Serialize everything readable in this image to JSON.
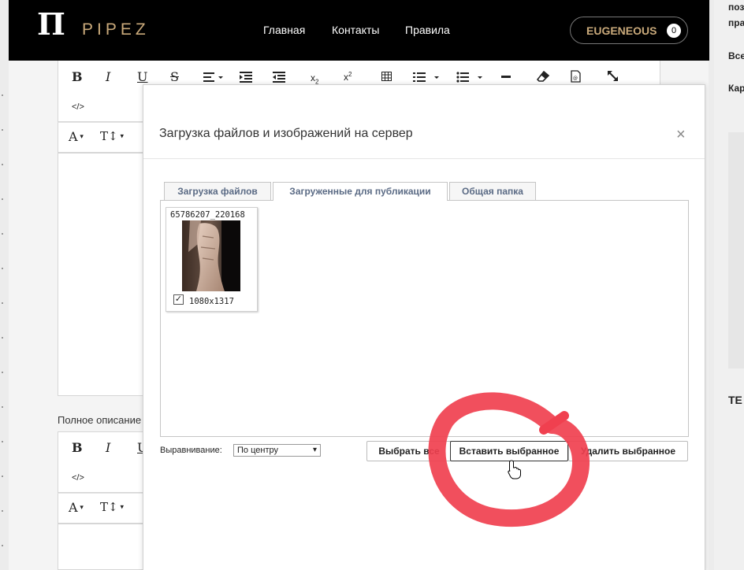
{
  "header": {
    "logo_mark": "П",
    "logo_text": "PIPEZ",
    "nav": [
      "Главная",
      "Контакты",
      "Правила"
    ],
    "user_name": "EUGENEOUS",
    "user_count": "0"
  },
  "right_panel": {
    "text_lines": [
      "поз",
      "пра",
      "Все",
      "Кар",
      "TE"
    ]
  },
  "editor": {
    "full_description_label": "Полное описание"
  },
  "modal": {
    "title": "Загрузка файлов и изображений на сервер",
    "close_glyph": "×",
    "tabs": [
      "Загрузка файлов",
      "Загруженные для публикации",
      "Общая папка"
    ],
    "active_tab": "Загруженные для публикации",
    "file": {
      "name": "65786207_220168",
      "dimensions": "1080x1317",
      "checked": true
    },
    "align_label": "Выравнивание:",
    "align_value": "По центру",
    "buttons": {
      "select_all": "Выбрать все",
      "insert_selected": "Вставить выбранное",
      "delete_selected": "Удалить выбранное"
    }
  },
  "colors": {
    "header_bg": "#000000",
    "brand_gold": "#c9a97a",
    "annotation_red": "#f0404f",
    "tab_text": "#5b6b85"
  }
}
